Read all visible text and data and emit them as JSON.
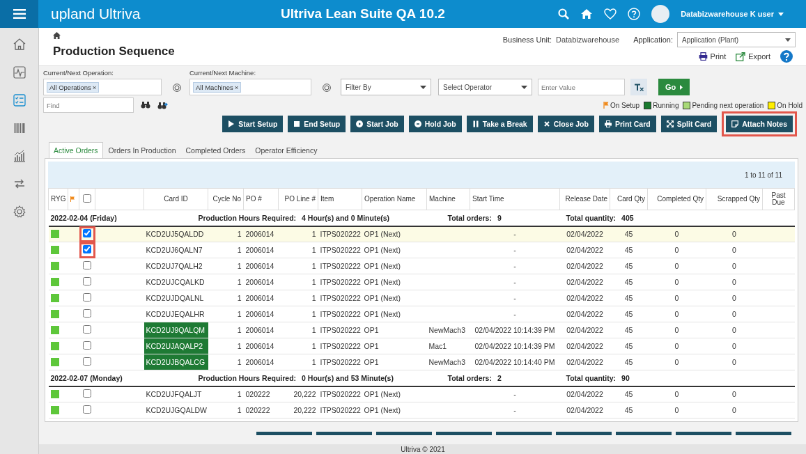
{
  "topbar": {
    "logo": "upland Ultriva",
    "title": "Ultriva Lean Suite QA 10.2",
    "user": "Databizwarehouse K user"
  },
  "sidebar": {
    "items": [
      {
        "selected": false
      },
      {
        "selected": false
      },
      {
        "selected": true
      },
      {
        "selected": false
      },
      {
        "selected": false
      },
      {
        "selected": false
      },
      {
        "selected": false
      }
    ]
  },
  "header": {
    "page_title": "Production Sequence",
    "business_unit_label": "Business Unit:",
    "business_unit": "Databizwarehouse",
    "application_label": "Application:",
    "application": "Application (Plant)",
    "print": "Print",
    "export": "Export"
  },
  "filters": {
    "operation_label": "Current/Next Operation:",
    "operation_tag": {
      "label": "All Operations",
      "remove": "×"
    },
    "machine_label": "Current/Next Machine:",
    "machine_tag": {
      "label": "All Machines",
      "remove": "×"
    },
    "filter_by": "Filter By",
    "operator": "Select Operator",
    "value_placeholder": "Enter Value",
    "go": "Go",
    "find_placeholder": "Find"
  },
  "legend": [
    {
      "kind": "flag",
      "label": "On Setup",
      "color": "#f08a1c"
    },
    {
      "kind": "square",
      "label": "Running",
      "color": "#1a7a2e"
    },
    {
      "kind": "square",
      "label": "Pending next operation",
      "color": "#a8d977"
    },
    {
      "kind": "square",
      "label": "On Hold",
      "color": "#ffee00"
    }
  ],
  "actions": [
    {
      "label": "Start Setup",
      "highlighted": false
    },
    {
      "label": "End Setup",
      "highlighted": false
    },
    {
      "label": "Start Job",
      "highlighted": false
    },
    {
      "label": "Hold Job",
      "highlighted": false
    },
    {
      "label": "Take a Break",
      "highlighted": false
    },
    {
      "label": "Close Job",
      "highlighted": false
    },
    {
      "label": "Print Card",
      "highlighted": false
    },
    {
      "label": "Split Card",
      "highlighted": false
    },
    {
      "label": "Attach Notes",
      "highlighted": true
    }
  ],
  "tabs": [
    {
      "label": "Active Orders",
      "selected": true
    },
    {
      "label": "Orders In Production",
      "selected": false
    },
    {
      "label": "Completed Orders",
      "selected": false
    },
    {
      "label": "Operator Efficiency",
      "selected": false
    }
  ],
  "table": {
    "pager": "1 to 11 of 11",
    "header_checked": false,
    "columns": [
      "RYG",
      "Card ID",
      "Cycle No",
      "PO #",
      "PO Line #",
      "Item",
      "Operation Name",
      "Machine",
      "Start Time",
      "Release Date",
      "Card Qty",
      "Completed Qty",
      "Scrapped Qty",
      "Past Due"
    ],
    "groups": [
      {
        "date": "2022-02-04 (Friday)",
        "hours_label": "Production Hours Required:",
        "hours": "4 Hour(s) and 0 Minute(s)",
        "orders_label": "Total orders:",
        "orders": "9",
        "quantity_label": "Total quantity:",
        "quantity": "405",
        "rows": [
          {
            "color": "#5ec73a",
            "checked": true,
            "highlighted": true,
            "selected": true,
            "running": false,
            "card_id": "KCD2UJ5QALDD",
            "cycle": "1",
            "po": "2006014",
            "po_line": "1",
            "item": "ITPS020222",
            "operation": "OP1 (Next)",
            "machine": "",
            "start": "-",
            "release": "02/04/2022",
            "qty": "45",
            "completed": "0",
            "scrapped": "0"
          },
          {
            "color": "#5ec73a",
            "checked": true,
            "highlighted": true,
            "selected": false,
            "running": false,
            "card_id": "KCD2UJ6QALN7",
            "cycle": "1",
            "po": "2006014",
            "po_line": "1",
            "item": "ITPS020222",
            "operation": "OP1 (Next)",
            "machine": "",
            "start": "-",
            "release": "02/04/2022",
            "qty": "45",
            "completed": "0",
            "scrapped": "0"
          },
          {
            "color": "#5ec73a",
            "checked": false,
            "highlighted": false,
            "selected": false,
            "running": false,
            "card_id": "KCD2UJ7QALH2",
            "cycle": "1",
            "po": "2006014",
            "po_line": "1",
            "item": "ITPS020222",
            "operation": "OP1 (Next)",
            "machine": "",
            "start": "-",
            "release": "02/04/2022",
            "qty": "45",
            "completed": "0",
            "scrapped": "0"
          },
          {
            "color": "#5ec73a",
            "checked": false,
            "highlighted": false,
            "selected": false,
            "running": false,
            "card_id": "KCD2UJCQALKD",
            "cycle": "1",
            "po": "2006014",
            "po_line": "1",
            "item": "ITPS020222",
            "operation": "OP1 (Next)",
            "machine": "",
            "start": "-",
            "release": "02/04/2022",
            "qty": "45",
            "completed": "0",
            "scrapped": "0"
          },
          {
            "color": "#5ec73a",
            "checked": false,
            "highlighted": false,
            "selected": false,
            "running": false,
            "card_id": "KCD2UJDQALNL",
            "cycle": "1",
            "po": "2006014",
            "po_line": "1",
            "item": "ITPS020222",
            "operation": "OP1 (Next)",
            "machine": "",
            "start": "-",
            "release": "02/04/2022",
            "qty": "45",
            "completed": "0",
            "scrapped": "0"
          },
          {
            "color": "#5ec73a",
            "checked": false,
            "highlighted": false,
            "selected": false,
            "running": false,
            "card_id": "KCD2UJEQALHR",
            "cycle": "1",
            "po": "2006014",
            "po_line": "1",
            "item": "ITPS020222",
            "operation": "OP1 (Next)",
            "machine": "",
            "start": "-",
            "release": "02/04/2022",
            "qty": "45",
            "completed": "0",
            "scrapped": "0"
          },
          {
            "color": "#5ec73a",
            "checked": false,
            "highlighted": false,
            "selected": false,
            "running": true,
            "card_id": "KCD2UJ9QALQM",
            "cycle": "1",
            "po": "2006014",
            "po_line": "1",
            "item": "ITPS020222",
            "operation": "OP1",
            "machine": "NewMach3",
            "start": "02/04/2022 10:14:39 PM",
            "release": "02/04/2022",
            "qty": "45",
            "completed": "0",
            "scrapped": "0"
          },
          {
            "color": "#5ec73a",
            "checked": false,
            "highlighted": false,
            "selected": false,
            "running": true,
            "card_id": "KCD2UJAQALP2",
            "cycle": "1",
            "po": "2006014",
            "po_line": "1",
            "item": "ITPS020222",
            "operation": "OP1",
            "machine": "Mac1",
            "start": "02/04/2022 10:14:39 PM",
            "release": "02/04/2022",
            "qty": "45",
            "completed": "0",
            "scrapped": "0"
          },
          {
            "color": "#5ec73a",
            "checked": false,
            "highlighted": false,
            "selected": false,
            "running": true,
            "card_id": "KCD2UJBQALCG",
            "cycle": "1",
            "po": "2006014",
            "po_line": "1",
            "item": "ITPS020222",
            "operation": "OP1",
            "machine": "NewMach3",
            "start": "02/04/2022 10:14:40 PM",
            "release": "02/04/2022",
            "qty": "45",
            "completed": "0",
            "scrapped": "0"
          }
        ]
      },
      {
        "date": "2022-02-07 (Monday)",
        "hours_label": "Production Hours Required:",
        "hours": "0 Hour(s) and 53 Minute(s)",
        "orders_label": "Total orders:",
        "orders": "2",
        "quantity_label": "Total quantity:",
        "quantity": "90",
        "rows": [
          {
            "color": "#5ec73a",
            "checked": false,
            "highlighted": false,
            "selected": false,
            "running": false,
            "card_id": "KCD2UJFQALJT",
            "cycle": "1",
            "po": "020222",
            "po_line": "20,222",
            "item": "ITPS020222",
            "operation": "OP1 (Next)",
            "machine": "",
            "start": "-",
            "release": "02/04/2022",
            "qty": "45",
            "completed": "0",
            "scrapped": "0"
          },
          {
            "color": "#5ec73a",
            "checked": false,
            "highlighted": false,
            "selected": false,
            "running": false,
            "card_id": "KCD2UJGQALDW",
            "cycle": "1",
            "po": "020222",
            "po_line": "20,222",
            "item": "ITPS020222",
            "operation": "OP1 (Next)",
            "machine": "",
            "start": "-",
            "release": "02/04/2022",
            "qty": "45",
            "completed": "0",
            "scrapped": "0"
          }
        ]
      }
    ]
  },
  "footer": "Ultriva © 2021"
}
